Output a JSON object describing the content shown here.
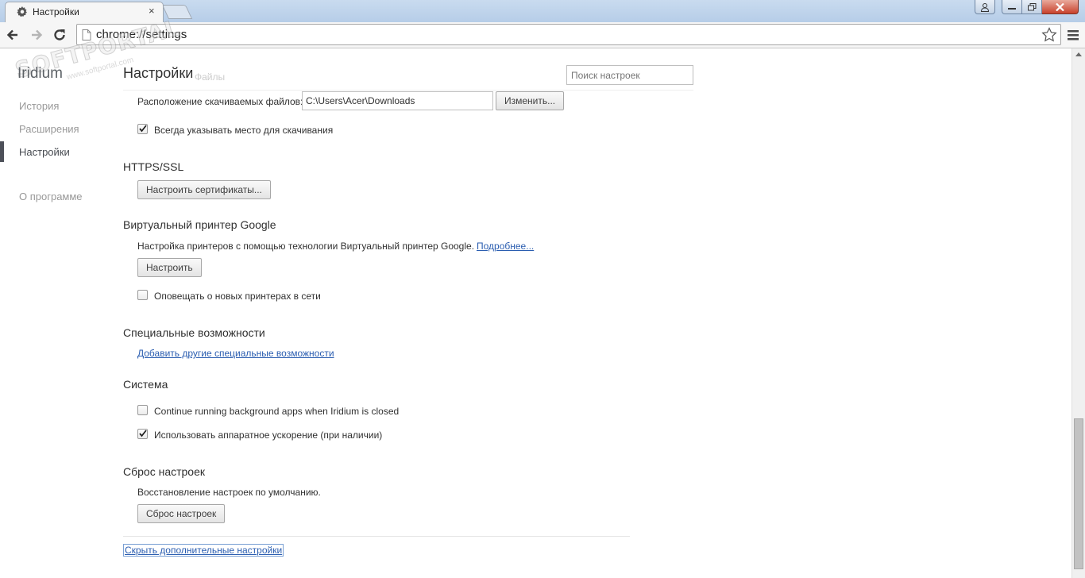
{
  "window": {
    "tab_title": "Настройки",
    "tab_close": "×"
  },
  "toolbar": {
    "url": "chrome://settings"
  },
  "sidebar": {
    "brand": "Iridium",
    "items": [
      {
        "label": "История"
      },
      {
        "label": "Расширения"
      },
      {
        "label": "Настройки"
      },
      {
        "label": "О программе"
      }
    ]
  },
  "watermark": {
    "main": "SOFTPORTAL",
    "sub": "www.softportal.com"
  },
  "header": {
    "title": "Настройки",
    "ghost_text": "Файлы",
    "search_placeholder": "Поиск настроек"
  },
  "downloads": {
    "location_label": "Расположение скачиваемых файлов:",
    "location_value": "C:\\Users\\Acer\\Downloads",
    "change_button": "Изменить...",
    "ask_label": "Всегда указывать место для скачивания",
    "ask_checked": true
  },
  "https": {
    "heading": "HTTPS/SSL",
    "certs_button": "Настроить сертификаты..."
  },
  "cloud_print": {
    "heading": "Виртуальный принтер Google",
    "description": "Настройка принтеров с помощью технологии Виртуальный принтер Google.",
    "learn_more": "Подробнее...",
    "setup_button": "Настроить",
    "notify_label": "Оповещать о новых принтерах в сети",
    "notify_checked": false
  },
  "accessibility": {
    "heading": "Специальные возможности",
    "add_link": "Добавить другие специальные возможности"
  },
  "system": {
    "heading": "Система",
    "background_label": "Continue running background apps when Iridium is closed",
    "background_checked": false,
    "hw_accel_label": "Использовать аппаратное ускорение (при наличии)",
    "hw_accel_checked": true
  },
  "reset": {
    "heading": "Сброс настроек",
    "description": "Восстановление настроек по умолчанию.",
    "reset_button": "Сброс настроек"
  },
  "footer": {
    "hide_link": "Скрыть дополнительные настройки"
  },
  "colors": {
    "link": "#2a5db0",
    "close_button": "#c8412b"
  }
}
